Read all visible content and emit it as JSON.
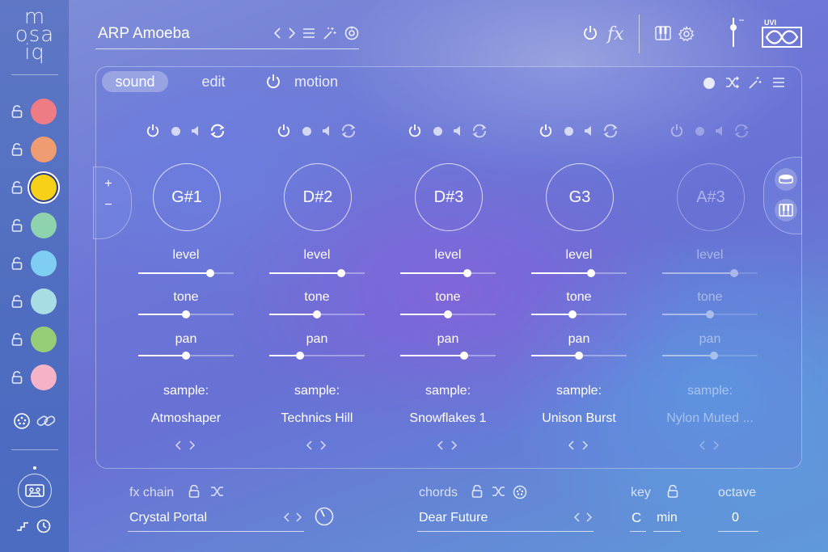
{
  "app": {
    "logo_lines": [
      "m",
      "osa",
      "iq"
    ],
    "brand_badge": "UVI"
  },
  "header": {
    "preset_name": "ARP Amoeba",
    "fx_label": "fx"
  },
  "tabs": [
    {
      "label": "sound",
      "active": true
    },
    {
      "label": "edit",
      "active": false
    },
    {
      "label": "motion",
      "active": false
    }
  ],
  "layers": [
    {
      "color": "#ef7b84",
      "active": false
    },
    {
      "color": "#f09c72",
      "active": false
    },
    {
      "color": "#f7d117",
      "active": true
    },
    {
      "color": "#8fd3ae",
      "active": false
    },
    {
      "color": "#7fcdf0",
      "active": false
    },
    {
      "color": "#a9dde6",
      "active": false
    },
    {
      "color": "#98cd78",
      "active": false
    },
    {
      "color": "#f4b3c6",
      "active": false
    }
  ],
  "param_labels": {
    "level": "level",
    "tone": "tone",
    "pan": "pan",
    "sample": "sample:"
  },
  "columns": [
    {
      "note": "G#1",
      "sample": "Atmoshaper",
      "level": 0.75,
      "tone": 0.5,
      "pan": 0.5,
      "enabled": true
    },
    {
      "note": "D#2",
      "sample": "Technics Hill",
      "level": 0.75,
      "tone": 0.5,
      "pan": 0.32,
      "enabled": true
    },
    {
      "note": "D#3",
      "sample": "Snowflakes 1",
      "level": 0.7,
      "tone": 0.5,
      "pan": 0.67,
      "enabled": true
    },
    {
      "note": "G3",
      "sample": "Unison Burst",
      "level": 0.63,
      "tone": 0.43,
      "pan": 0.5,
      "enabled": true
    },
    {
      "note": "A#3",
      "sample": "Nylon Muted ...",
      "level": 0.75,
      "tone": 0.5,
      "pan": 0.54,
      "enabled": false
    }
  ],
  "bottom": {
    "fx_chain_label": "fx chain",
    "fx_chain_value": "Crystal Portal",
    "chords_label": "chords",
    "chords_value": "Dear Future",
    "key_label": "key",
    "key_value": "C",
    "key_mode": "min",
    "octave_label": "octave",
    "octave_value": "0"
  },
  "side_buttons": {
    "plus": "+",
    "minus": "−"
  }
}
